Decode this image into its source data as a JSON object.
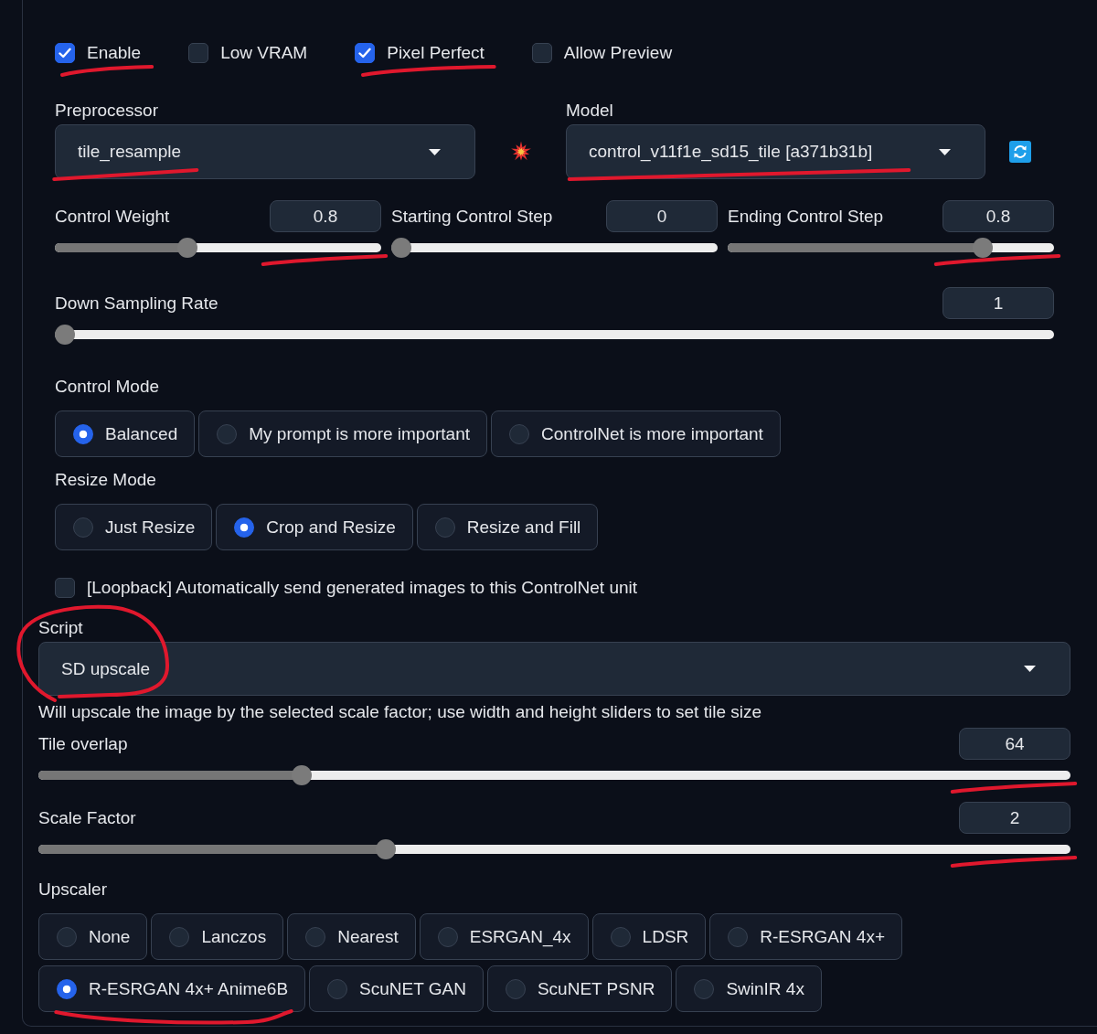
{
  "checkboxes": [
    {
      "label": "Enable",
      "checked": true,
      "underlined": true
    },
    {
      "label": "Low VRAM",
      "checked": false
    },
    {
      "label": "Pixel Perfect",
      "checked": true,
      "underlined": true
    },
    {
      "label": "Allow Preview",
      "checked": false
    }
  ],
  "preprocessor": {
    "label": "Preprocessor",
    "value": "tile_resample",
    "underlined": true
  },
  "model": {
    "label": "Model",
    "value": "control_v11f1e_sd15_tile [a371b31b]",
    "underlined": true
  },
  "sliders": [
    {
      "label": "Control Weight",
      "value": "0.8",
      "level": 0.4,
      "underlined": true
    },
    {
      "label": "Starting Control Step",
      "value": "0",
      "level": 0
    },
    {
      "label": "Ending Control Step",
      "value": "0.8",
      "level": 0.8,
      "underlined": true
    }
  ],
  "down_sampling": {
    "label": "Down Sampling Rate",
    "value": "1",
    "level": 0
  },
  "control_mode": {
    "label": "Control Mode",
    "options": [
      {
        "label": "Balanced",
        "selected": true
      },
      {
        "label": "My prompt is more important",
        "selected": false
      },
      {
        "label": "ControlNet is more important",
        "selected": false
      }
    ]
  },
  "resize_mode": {
    "label": "Resize Mode",
    "options": [
      {
        "label": "Just Resize",
        "selected": false
      },
      {
        "label": "Crop and Resize",
        "selected": true
      },
      {
        "label": "Resize and Fill",
        "selected": false
      }
    ]
  },
  "loopback": {
    "label": "[Loopback] Automatically send generated images to this ControlNet unit",
    "checked": false
  },
  "script": {
    "label": "Script",
    "value": "SD upscale",
    "circled": true,
    "info": "Will upscale the image by the selected scale factor; use width and height sliders to set tile size"
  },
  "script_sliders": [
    {
      "label": "Tile overlap",
      "value": "64",
      "level": 0.25,
      "underlined": true
    },
    {
      "label": "Scale Factor",
      "value": "2",
      "level": 0.333,
      "underlined": true
    }
  ],
  "upscaler": {
    "label": "Upscaler",
    "options": [
      {
        "label": "None",
        "selected": false
      },
      {
        "label": "Lanczos",
        "selected": false
      },
      {
        "label": "Nearest",
        "selected": false
      },
      {
        "label": "ESRGAN_4x",
        "selected": false
      },
      {
        "label": "LDSR",
        "selected": false
      },
      {
        "label": "R-ESRGAN 4x+",
        "selected": false
      },
      {
        "label": "R-ESRGAN 4x+ Anime6B",
        "selected": true,
        "underlined": true
      },
      {
        "label": "ScuNET GAN",
        "selected": false
      },
      {
        "label": "ScuNET PSNR",
        "selected": false
      },
      {
        "label": "SwinIR 4x",
        "selected": false
      }
    ]
  }
}
